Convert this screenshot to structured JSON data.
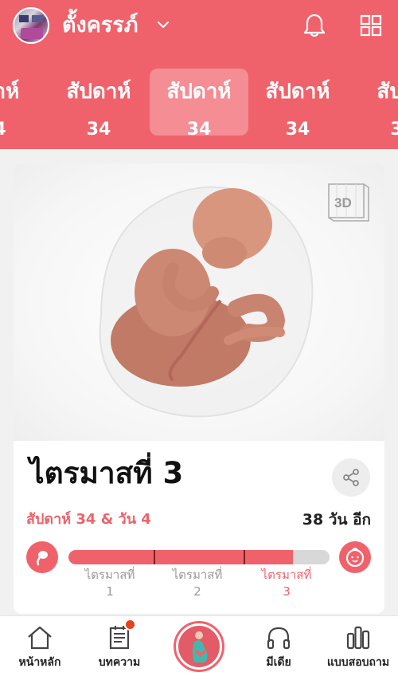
{
  "header": {
    "profile_name": "ตั้งครรภ์",
    "icons": {
      "dropdown": "chevron-down-icon",
      "notifications": "bell-icon",
      "menu": "grid-icon"
    }
  },
  "week_tabs": [
    {
      "label": "ดาห์",
      "number": "4"
    },
    {
      "label": "สัปดาห์",
      "number": "34"
    },
    {
      "label": "สัปดาห์",
      "number": "34",
      "active": true
    },
    {
      "label": "สัปดาห์",
      "number": "34"
    },
    {
      "label": "สัปด",
      "number": "3"
    }
  ],
  "card": {
    "badge_3d": "3D",
    "trimester_title": "ไตรมาสที่ 3",
    "week_day": "สัปดาห์ 34 & วัน 4",
    "days_left": "38 วัน อีก",
    "progress": {
      "value_percent": 86,
      "tick_percents": [
        32.5,
        67
      ]
    },
    "trimesters": [
      {
        "label": "ไตรมาสที่",
        "number": "1",
        "active": false
      },
      {
        "label": "ไตรมาสที่",
        "number": "2",
        "active": false
      },
      {
        "label": "ไตรมาสที่",
        "number": "3",
        "active": true
      }
    ]
  },
  "bottom_nav": {
    "items": [
      {
        "label": "หน้าหลัก",
        "icon": "home-icon"
      },
      {
        "label": "บทความ",
        "icon": "article-icon",
        "has_notification": true
      },
      {
        "label": "",
        "icon": "pregnancy-icon"
      },
      {
        "label": "มีเดีย",
        "icon": "headphones-icon"
      },
      {
        "label": "แบบสอบถาม",
        "icon": "bar-chart-icon"
      }
    ]
  },
  "colors": {
    "brand": "#f0626b",
    "notification": "#e8421a",
    "text": "#111111",
    "muted": "#9a9a9a"
  }
}
